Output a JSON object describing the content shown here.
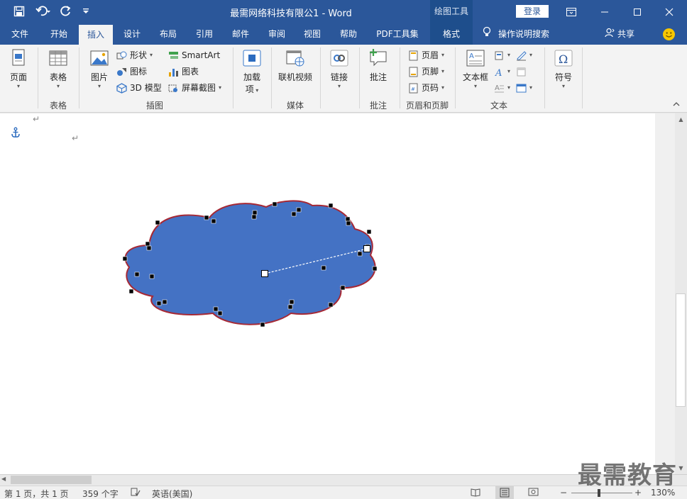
{
  "titlebar": {
    "title": "最需网络科技有限公1  -  Word",
    "context_tools": "绘图工具",
    "login": "登录"
  },
  "tabs": [
    {
      "label": "文件"
    },
    {
      "label": "开始"
    },
    {
      "label": "插入"
    },
    {
      "label": "设计"
    },
    {
      "label": "布局"
    },
    {
      "label": "引用"
    },
    {
      "label": "邮件"
    },
    {
      "label": "审阅"
    },
    {
      "label": "视图"
    },
    {
      "label": "帮助"
    },
    {
      "label": "PDF工具集"
    },
    {
      "label": "格式"
    }
  ],
  "tell_me": "操作说明搜索",
  "share": "共享",
  "ribbon": {
    "pages": {
      "button": "页面",
      "group": ""
    },
    "tables": {
      "button": "表格",
      "group": "表格"
    },
    "illustrations": {
      "group": "插图",
      "picture": "图片",
      "shapes": "形状",
      "icons": "图标",
      "model3d": "3D 模型",
      "smartart": "SmartArt",
      "chart": "图表",
      "screenshot": "屏幕截图"
    },
    "addins": {
      "button_line1": "加载",
      "button_line2": "项"
    },
    "media": {
      "button": "联机视频",
      "group": "媒体"
    },
    "links": {
      "button": "链接"
    },
    "comments": {
      "button": "批注",
      "group": "批注"
    },
    "header_footer": {
      "group": "页眉和页脚",
      "header": "页眉",
      "footer": "页脚",
      "page_number": "页码"
    },
    "text": {
      "group": "文本",
      "textbox": "文本框"
    },
    "symbols": {
      "button": "符号"
    }
  },
  "document": {
    "paragraph_mark": "↵",
    "shape": {
      "fill": "#4472c4",
      "outline": "#a62935"
    }
  },
  "statusbar": {
    "page": "第 1 页，共 1 页",
    "words": "359 个字",
    "language": "英语(美国)",
    "zoom": "130%",
    "zoom_minus": "−",
    "zoom_plus": "+"
  },
  "watermark": "最需教育",
  "colors": {
    "accent": "#2b579a",
    "ribbon_bg": "#f3f3f3"
  }
}
